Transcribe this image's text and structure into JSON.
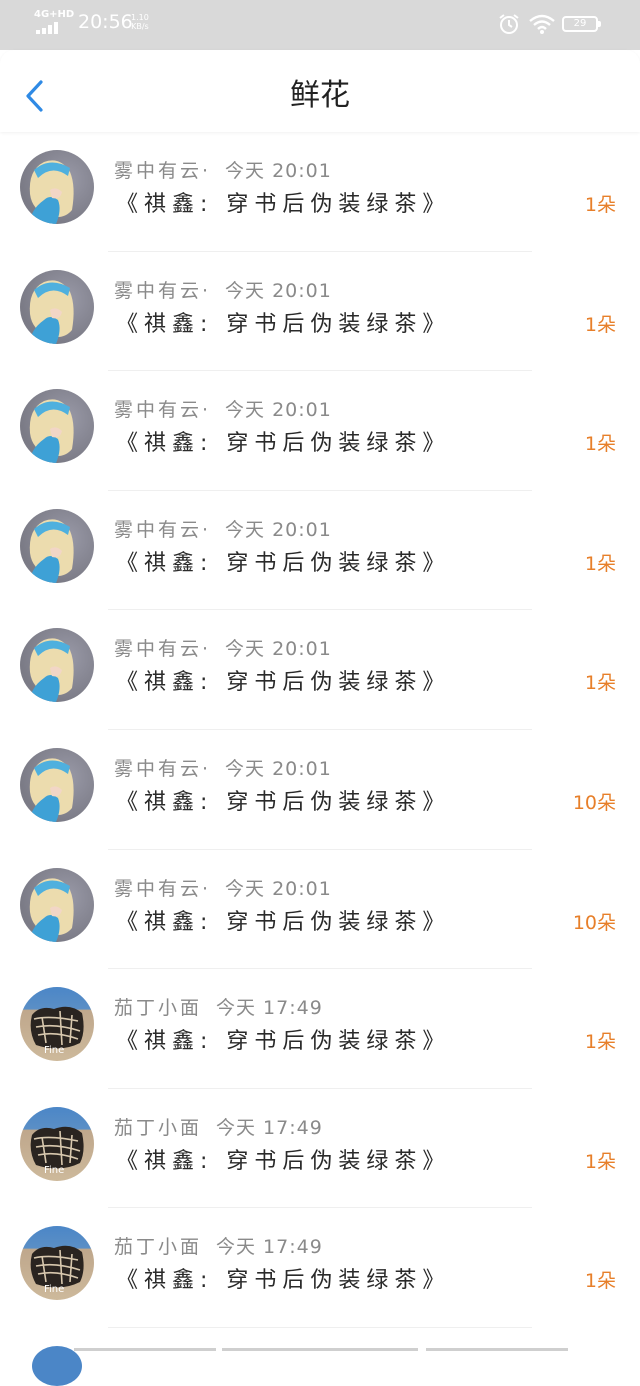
{
  "status_bar": {
    "network": "4G+HD",
    "time": "20:56",
    "speed_value": "1.10",
    "speed_unit": "KB/s",
    "battery": "29"
  },
  "header": {
    "title": "鲜花"
  },
  "colors": {
    "accent_blue": "#2f8ae5",
    "amount_orange": "#e77f2a"
  },
  "rows": [
    {
      "user": "雾中有云·",
      "time": "今天 20:01",
      "book": "《祺鑫: 穿书后伪装绿茶》",
      "amount": "1朵",
      "avatar": "blonde-girl-icon"
    },
    {
      "user": "雾中有云·",
      "time": "今天 20:01",
      "book": "《祺鑫: 穿书后伪装绿茶》",
      "amount": "1朵",
      "avatar": "blonde-girl-icon"
    },
    {
      "user": "雾中有云·",
      "time": "今天 20:01",
      "book": "《祺鑫: 穿书后伪装绿茶》",
      "amount": "1朵",
      "avatar": "blonde-girl-icon"
    },
    {
      "user": "雾中有云·",
      "time": "今天 20:01",
      "book": "《祺鑫: 穿书后伪装绿茶》",
      "amount": "1朵",
      "avatar": "blonde-girl-icon"
    },
    {
      "user": "雾中有云·",
      "time": "今天 20:01",
      "book": "《祺鑫: 穿书后伪装绿茶》",
      "amount": "1朵",
      "avatar": "blonde-girl-icon"
    },
    {
      "user": "雾中有云·",
      "time": "今天 20:01",
      "book": "《祺鑫: 穿书后伪装绿茶》",
      "amount": "10朵",
      "avatar": "blonde-girl-icon"
    },
    {
      "user": "雾中有云·",
      "time": "今天 20:01",
      "book": "《祺鑫: 穿书后伪装绿茶》",
      "amount": "10朵",
      "avatar": "blonde-girl-icon"
    },
    {
      "user": "茄丁小面",
      "time": "今天 17:49",
      "book": "《祺鑫: 穿书后伪装绿茶》",
      "amount": "1朵",
      "avatar": "fine-cat-icon",
      "avatar_text": "Fine"
    },
    {
      "user": "茄丁小面",
      "time": "今天 17:49",
      "book": "《祺鑫: 穿书后伪装绿茶》",
      "amount": "1朵",
      "avatar": "fine-cat-icon",
      "avatar_text": "Fine"
    },
    {
      "user": "茄丁小面",
      "time": "今天 17:49",
      "book": "《祺鑫: 穿书后伪装绿茶》",
      "amount": "1朵",
      "avatar": "fine-cat-icon",
      "avatar_text": "Fine"
    }
  ]
}
